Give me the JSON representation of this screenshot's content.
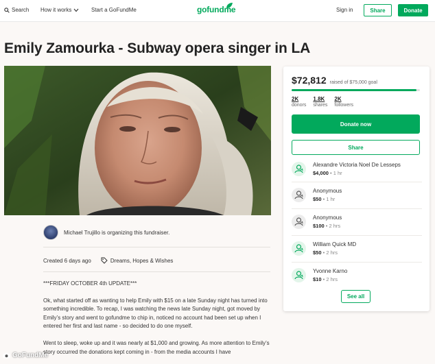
{
  "header": {
    "search_label": "Search",
    "how_it_works_label": "How it works",
    "start_label": "Start a GoFundMe",
    "logo_text": "gofundme",
    "signin_label": "Sign in",
    "share_label": "Share",
    "donate_label": "Donate"
  },
  "campaign": {
    "title": "Emily Zamourka - Subway opera singer in LA",
    "organizer_text": "Michael Trujillo is organizing this fundraiser.",
    "created": "Created 6 days ago",
    "category": "Dreams, Hopes & Wishes",
    "story": [
      "***FRIDAY OCTOBER 4th UPDATE***",
      "Ok, what started off as wanting to help Emily with $15 on a late Sunday night has turned into something incredible.  To recap, I was watching the news late Sunday night, got moved by Emily’s story and went to gofundme to chip in, noticed no account had been set up when I entered her first and last name - so decided to do one myself.",
      "Went to sleep, woke up and it was nearly at $1,000 and growing.  As more attention to Emily’s story occurred the donations kept coming in - from the media accounts I have"
    ]
  },
  "sidebar": {
    "raised_amount": "$72,812",
    "raised_goal": "raised of $75,000 goal",
    "progress_fraction": 0.971,
    "stats": [
      {
        "num": "2K",
        "label": "donors"
      },
      {
        "num": "1.8K",
        "label": "shares"
      },
      {
        "num": "2K",
        "label": "followers"
      }
    ],
    "donate_now_label": "Donate now",
    "share_label": "Share",
    "donations": [
      {
        "name": "Alexandre Victoria Noel De Lesseps",
        "amount": "$4,000",
        "time": "1 hr",
        "style": "green"
      },
      {
        "name": "Anonymous",
        "amount": "$50",
        "time": "1 hr",
        "style": "gray"
      },
      {
        "name": "Anonymous",
        "amount": "$100",
        "time": "2 hrs",
        "style": "gray"
      },
      {
        "name": "William Quick MD",
        "amount": "$50",
        "time": "2 hrs",
        "style": "green"
      },
      {
        "name": "Yvonne Karno",
        "amount": "$10",
        "time": "2 hrs",
        "style": "green"
      }
    ],
    "see_all_label": "See all"
  },
  "watermark": "GoFundMe",
  "colors": {
    "brand_green": "#02a95c"
  }
}
